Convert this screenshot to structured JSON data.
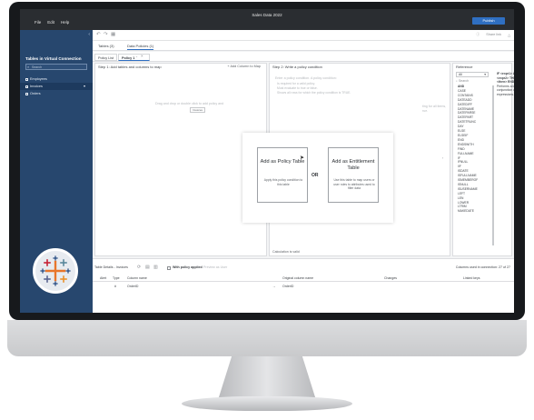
{
  "app": {
    "title": "Sales Data 2022",
    "publish_label": "Publish",
    "menu": [
      "File",
      "Edit",
      "Help"
    ]
  },
  "left_panel": {
    "title": "Tables in Virtual Connection",
    "search_placeholder": "Search",
    "items": [
      {
        "label": "Employees",
        "selected": false
      },
      {
        "label": "Invoices",
        "selected": true
      },
      {
        "label": "Orders",
        "selected": false
      }
    ]
  },
  "toolbar": {
    "right_items": [
      "Share link"
    ]
  },
  "tabs": {
    "primary": [
      "Tables (3)",
      "Data Policies (1)"
    ],
    "secondary": [
      "Policy List",
      "Policy 1"
    ]
  },
  "step1": {
    "header": "Step 1: Add tables and columns to map",
    "add_column": "+ Add Column to Map",
    "hint": "Drag and drop or double click to add policy and",
    "chip": "Invoices"
  },
  "step2": {
    "header": "Step 2: Write a policy condition",
    "placeholder": "Enter a policy condition. A policy condition:",
    "bullets": [
      "Is required for a valid policy.",
      "Must evaluate to true or false.",
      "Shows all rows for which the policy condition is TRUE."
    ],
    "side_text": "ting for all items,",
    "side_text2": "rue.",
    "footer": "Calculation is valid"
  },
  "reference": {
    "title": "Reference",
    "filter": "All",
    "search": "Search",
    "items": [
      "AND",
      "CASE",
      "CONTAINS",
      "DATEADD",
      "DATEDIFF",
      "DATENAME",
      "DATEPARSE",
      "DATEPART",
      "DATETRUNC",
      "DAY",
      "ELSE",
      "ELSEIF",
      "END",
      "ENDSWITH",
      "FIND",
      "FULLNAME",
      "IF",
      "IFNULL",
      "IIF",
      "ISDATE",
      "ISFULLNAME",
      "ISMEMBEROF",
      "ISNULL",
      "ISUSERNAME",
      "LEFT",
      "LEN",
      "LOWER",
      "LTRIM",
      "MAKEDATE"
    ],
    "desc_syntax": "IF <expr1> AND <expr2> THEN <then> END",
    "desc_text": "Performs a logical conjunction on two expressions."
  },
  "modal": {
    "policy_title": "Add as Policy Table",
    "policy_desc": "Apply this policy condition to this table",
    "or_label": "OR",
    "entitlement_title": "Add as Entitlement Table",
    "entitlement_desc": "Use this table to map users or user roles to attributes used to filter data"
  },
  "bottom": {
    "title": "Table Details - Invoices",
    "with_policy": "With policy applied",
    "preview": "Preview as User",
    "columns_used": "Columns used in connection: 27 of 27",
    "headers": [
      "Alert",
      "Type",
      "Column name",
      "Original column name",
      "Changes",
      "Linked keys"
    ],
    "rows": [
      {
        "type": "#",
        "column": "OrderID",
        "original": "OrderID"
      }
    ]
  },
  "colors": {
    "topbar": "#2a2d31",
    "leftpanel": "#27476e",
    "accent": "#2f6fc2"
  }
}
